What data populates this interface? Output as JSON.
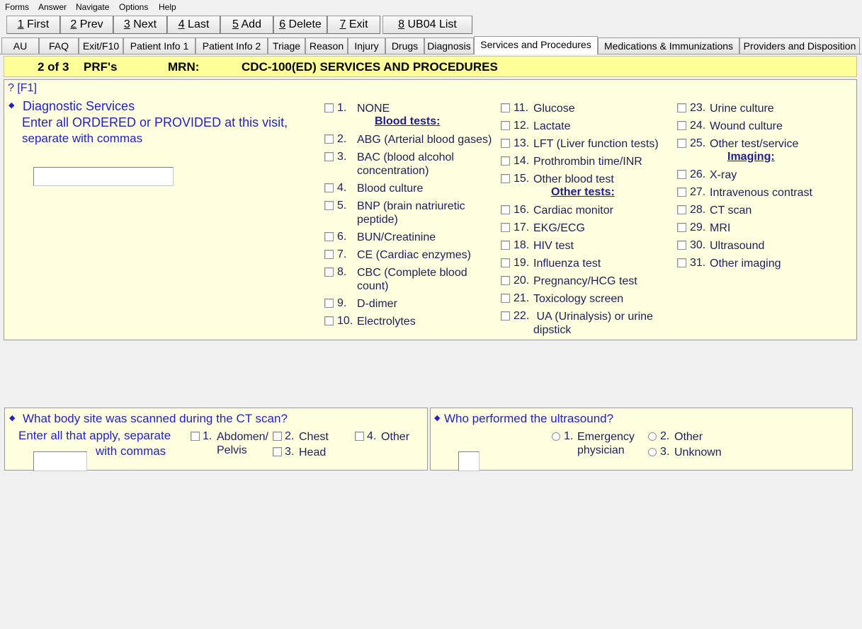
{
  "menu": [
    "Forms",
    "Answer",
    "Navigate",
    "Options",
    "Help"
  ],
  "toolbar": [
    {
      "key": "1",
      "label": " First"
    },
    {
      "key": "2",
      "label": " Prev"
    },
    {
      "key": "3",
      "label": " Next"
    },
    {
      "key": "4",
      "label": " Last"
    },
    {
      "key": "5",
      "label": " Add"
    },
    {
      "key": "6",
      "label": " Delete"
    },
    {
      "key": "7",
      "label": " Exit"
    },
    {
      "key": "8",
      "label": " UB04 List"
    }
  ],
  "tabs": [
    "AU",
    "FAQ",
    "Exit/F10",
    "Patient Info 1",
    "Patient Info 2",
    "Triage",
    "Reason",
    "Injury",
    "Drugs",
    "Diagnosis",
    "Services and Procedures",
    "Medications & Immunizations",
    "Providers and Disposition"
  ],
  "header": {
    "record": "2 of 3",
    "prf": "PRF's",
    "mrn_label": "MRN:",
    "form_title": "CDC-100(ED) SERVICES AND PROCEDURES"
  },
  "diagnostic": {
    "help": "? [F1]",
    "title": "Diagnostic Services",
    "instruction_1": "Enter all ORDERED or PROVIDED at this visit,",
    "instruction_2": "separate with commas",
    "input_value": "",
    "blood_tests_heading": "Blood tests:",
    "other_tests_heading": "Other tests:",
    "imaging_heading": "Imaging:",
    "options": [
      {
        "num": "1.",
        "lines": [
          "NONE"
        ]
      },
      {
        "num": "2.",
        "lines": [
          "ABG (Arterial blood gases)"
        ]
      },
      {
        "num": "3.",
        "lines": [
          "BAC (blood alcohol",
          "concentration)"
        ]
      },
      {
        "num": "4.",
        "lines": [
          "Blood culture"
        ]
      },
      {
        "num": "5.",
        "lines": [
          "BNP (brain natriuretic",
          "peptide)"
        ]
      },
      {
        "num": "6.",
        "lines": [
          "BUN/Creatinine"
        ]
      },
      {
        "num": "7.",
        "lines": [
          "CE (Cardiac enzymes)"
        ]
      },
      {
        "num": "8.",
        "lines": [
          "CBC (Complete blood",
          "count)"
        ]
      },
      {
        "num": "9.",
        "lines": [
          "D-dimer"
        ]
      },
      {
        "num": "10.",
        "lines": [
          "Electrolytes"
        ]
      },
      {
        "num": "11.",
        "lines": [
          "Glucose"
        ]
      },
      {
        "num": "12.",
        "lines": [
          "Lactate"
        ]
      },
      {
        "num": "13.",
        "lines": [
          "LFT (Liver function tests)"
        ]
      },
      {
        "num": "14.",
        "lines": [
          "Prothrombin time/INR"
        ]
      },
      {
        "num": "15.",
        "lines": [
          "Other blood test"
        ]
      },
      {
        "num": "16.",
        "lines": [
          "Cardiac monitor"
        ]
      },
      {
        "num": "17.",
        "lines": [
          "EKG/ECG"
        ]
      },
      {
        "num": "18.",
        "lines": [
          "HIV test"
        ]
      },
      {
        "num": "19.",
        "lines": [
          "Influenza test"
        ]
      },
      {
        "num": "20.",
        "lines": [
          "Pregnancy/HCG test"
        ]
      },
      {
        "num": "21.",
        "lines": [
          "Toxicology screen"
        ]
      },
      {
        "num": "22.",
        "lines": [
          " UA (Urinalysis) or urine",
          "dipstick"
        ]
      },
      {
        "num": "23.",
        "lines": [
          "Urine culture"
        ]
      },
      {
        "num": "24.",
        "lines": [
          "Wound culture"
        ]
      },
      {
        "num": "25.",
        "lines": [
          "Other test/service"
        ]
      },
      {
        "num": "26.",
        "lines": [
          "X-ray"
        ]
      },
      {
        "num": "27.",
        "lines": [
          "Intravenous contrast"
        ]
      },
      {
        "num": "28.",
        "lines": [
          "CT scan"
        ]
      },
      {
        "num": "29.",
        "lines": [
          "MRI"
        ]
      },
      {
        "num": "30.",
        "lines": [
          "Ultrasound"
        ]
      },
      {
        "num": "31.",
        "lines": [
          "Other imaging"
        ]
      }
    ]
  },
  "ct_site": {
    "question": "What body site was scanned during the CT scan?",
    "instruction_1": "Enter all that apply, separate",
    "instruction_2": "with commas",
    "input_value": "",
    "options": [
      {
        "num": "1.",
        "lines": [
          "Abdomen/",
          "Pelvis"
        ]
      },
      {
        "num": "2.",
        "lines": [
          "Chest"
        ]
      },
      {
        "num": "3.",
        "lines": [
          "Head"
        ]
      },
      {
        "num": "4.",
        "lines": [
          "Other"
        ]
      }
    ]
  },
  "ultrasound": {
    "question": "Who performed the ultrasound?",
    "input_value": "",
    "options": [
      {
        "num": "1.",
        "lines": [
          "Emergency",
          "physician"
        ]
      },
      {
        "num": "2.",
        "lines": [
          "Other"
        ]
      },
      {
        "num": "3.",
        "lines": [
          "Unknown"
        ]
      }
    ]
  }
}
